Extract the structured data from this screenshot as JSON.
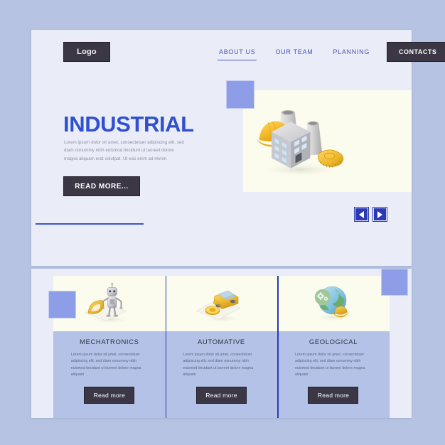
{
  "page": {
    "background_color": "#b6c3e2",
    "panel_color": "#eaedf7",
    "accent_blue": "#3050d0",
    "dark_button": "#3b3744",
    "image_bg": "#fbfced",
    "card_body_color": "#b3c2e6",
    "deco_square_color": "#8e9de8"
  },
  "header": {
    "logo_label": "Logo",
    "nav": [
      {
        "label": "ABOUT US",
        "state": "underlined"
      },
      {
        "label": "OUR TEAM",
        "state": "default"
      },
      {
        "label": "PLANNING",
        "state": "default"
      },
      {
        "label": "CONTACTS",
        "state": "button"
      }
    ]
  },
  "hero": {
    "title": "INDUSTRIAL",
    "paragraph": "Lorem ipsum dolor sit amet, consectetuer adipiscing elit, sed diam nonummy nibh euismod tincidunt ut laoreet dolore magna aliquam erat volutpat. Ut wisi enim ad minim",
    "read_more_label": "READ MORE...",
    "image_alt": "isometric factory with hard hat, building, cooling towers and measuring tape",
    "prev_arrow_icon": "arrow-left-icon",
    "next_arrow_icon": "arrow-right-icon"
  },
  "cards": [
    {
      "title": "MECHATRONICS",
      "text": "Lorem ipsum dolor sit amet, consectetuer adipiscing elit, sed diam nonummy nibh euismod tincidunt ut laoreet dolore magna aliquam",
      "button_label": "Read more",
      "image_alt": "isometric robot with protractor and ruler"
    },
    {
      "title": "AUTOMATIVE",
      "text": "Lorem ipsum dolor sit amet, consectetuer adipiscing elit, sed diam nonummy nibh euismod tincidunt ut laoreet dolore magna aliquam",
      "button_label": "Read more",
      "image_alt": "isometric yellow car with tire"
    },
    {
      "title": "GEOLOGICAL",
      "text": "Lorem ipsum dolor sit amet, consectetuer adipiscing elit, sed diam nonummy nibh euismod tincidunt ut laoreet dolore magna aliquam",
      "button_label": "Read more",
      "image_alt": "isometric globe with gears and hard hat"
    }
  ]
}
